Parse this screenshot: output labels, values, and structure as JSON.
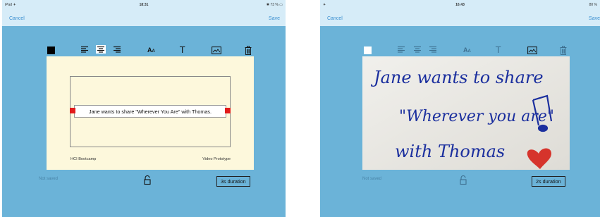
{
  "screen1": {
    "status": {
      "left": "iPad ✈",
      "time": "18:31",
      "right": "✱ 73 % ▭"
    },
    "nav": {
      "cancel": "Cancel",
      "save": "Save"
    },
    "toolbar": {
      "swatch_color": "#000000",
      "selected_align": "center",
      "font_glyph": "AA",
      "text_glyph": "T"
    },
    "card": {
      "text": "Jane wants to share \"Wherever You Are\" with Thomas.",
      "footer_left": "HCI Bootcamp",
      "footer_right": "Video Prototype"
    },
    "bottom": {
      "status": "Not saved",
      "duration": "3s duration"
    }
  },
  "screen2": {
    "status": {
      "left": "✈",
      "time": "16:43",
      "right": "80 %"
    },
    "nav": {
      "cancel": "Cancel",
      "save": "Save"
    },
    "toolbar": {
      "swatch_color": "#ffffff",
      "font_glyph": "AA",
      "text_glyph": "T"
    },
    "photo": {
      "handwriting_line1": "Jane wants to share",
      "handwriting_line2": "\"Wherever you are\"",
      "handwriting_line3": "with Thomas",
      "note_icon": "music-note-icon",
      "heart_icon": "heart-icon"
    },
    "bottom": {
      "status": "Not saved",
      "duration": "2s duration"
    }
  }
}
